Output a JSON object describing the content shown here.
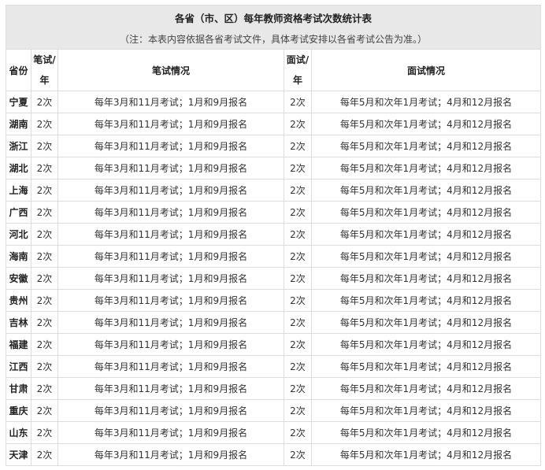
{
  "table": {
    "title": "各省（市、区）每年教师资格考试次数统计表",
    "note": "（注：本表内容依据各省考试文件，具体考试安排以各省考试公告为准。）",
    "headers": {
      "province": "省份",
      "written_count": "笔试/年",
      "written_info": "笔试情况",
      "interview_count": "面试/年",
      "interview_info": "面试情况"
    },
    "rows": [
      {
        "province": "宁夏",
        "written_count": "2次",
        "written_info": "每年3月和11月考试；1月和9月报名",
        "interview_count": "2次",
        "interview_info": "每年5月和次年1月考试；4月和12月报名"
      },
      {
        "province": "湖南",
        "written_count": "2次",
        "written_info": "每年3月和11月考试；1月和9月报名",
        "interview_count": "2次",
        "interview_info": "每年5月和次年1月考试；4月和12月报名"
      },
      {
        "province": "浙江",
        "written_count": "2次",
        "written_info": "每年3月和11月考试；1月和9月报名",
        "interview_count": "2次",
        "interview_info": "每年5月和次年1月考试；4月和12月报名"
      },
      {
        "province": "湖北",
        "written_count": "2次",
        "written_info": "每年3月和11月考试；1月和9月报名",
        "interview_count": "2次",
        "interview_info": "每年5月和次年1月考试；4月和12月报名"
      },
      {
        "province": "上海",
        "written_count": "2次",
        "written_info": "每年3月和11月考试；1月和9月报名",
        "interview_count": "2次",
        "interview_info": "每年5月和次年1月考试；4月和12月报名"
      },
      {
        "province": "广西",
        "written_count": "2次",
        "written_info": "每年3月和11月考试；1月和9月报名",
        "interview_count": "2次",
        "interview_info": "每年5月和次年1月考试；4月和12月报名"
      },
      {
        "province": "河北",
        "written_count": "2次",
        "written_info": "每年3月和11月考试；1月和9月报名",
        "interview_count": "2次",
        "interview_info": "每年5月和次年1月考试；4月和12月报名"
      },
      {
        "province": "海南",
        "written_count": "2次",
        "written_info": "每年3月和11月考试；1月和9月报名",
        "interview_count": "2次",
        "interview_info": "每年5月和次年1月考试；4月和12月报名"
      },
      {
        "province": "安徽",
        "written_count": "2次",
        "written_info": "每年3月和11月考试；1月和9月报名",
        "interview_count": "2次",
        "interview_info": "每年5月和次年1月考试；4月和12月报名"
      },
      {
        "province": "贵州",
        "written_count": "2次",
        "written_info": "每年3月和11月考试；1月和9月报名",
        "interview_count": "2次",
        "interview_info": "每年5月和次年1月考试；4月和12月报名"
      },
      {
        "province": "吉林",
        "written_count": "2次",
        "written_info": "每年3月和11月考试；1月和9月报名",
        "interview_count": "2次",
        "interview_info": "每年5月和次年1月考试；4月和12月报名"
      },
      {
        "province": "福建",
        "written_count": "2次",
        "written_info": "每年3月和11月考试；1月和9月报名",
        "interview_count": "2次",
        "interview_info": "每年5月和次年1月考试；4月和12月报名"
      },
      {
        "province": "江西",
        "written_count": "2次",
        "written_info": "每年3月和11月考试；1月和9月报名",
        "interview_count": "2次",
        "interview_info": "每年5月和次年1月考试；4月和12月报名"
      },
      {
        "province": "甘肃",
        "written_count": "2次",
        "written_info": "每年3月和11月考试；1月和9月报名",
        "interview_count": "2次",
        "interview_info": "每年5月和次年1月考试；4月和12月报名"
      },
      {
        "province": "重庆",
        "written_count": "2次",
        "written_info": "每年3月和11月考试；1月和9月报名",
        "interview_count": "2次",
        "interview_info": "每年5月和次年1月考试；4月和12月报名"
      },
      {
        "province": "山东",
        "written_count": "2次",
        "written_info": "每年3月和11月考试；1月和9月报名",
        "interview_count": "2次",
        "interview_info": "每年5月和次年1月考试；4月和12月报名"
      },
      {
        "province": "天津",
        "written_count": "2次",
        "written_info": "每年3月和11月考试；1月和9月报名",
        "interview_count": "2次",
        "interview_info": "每年5月和次年1月考试；4月和12月报名"
      }
    ]
  }
}
